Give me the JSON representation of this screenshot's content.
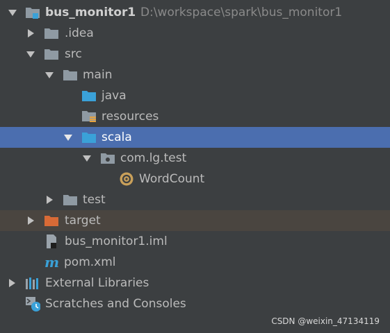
{
  "project": {
    "name": "bus_monitor1",
    "path": "D:\\workspace\\spark\\bus_monitor1"
  },
  "tree": {
    "idea": ".idea",
    "src": "src",
    "main": "main",
    "java": "java",
    "resources": "resources",
    "scala": "scala",
    "package": "com.lg.test",
    "wordcount": "WordCount",
    "test": "test",
    "target": "target",
    "iml": "bus_monitor1.iml",
    "pom": "pom.xml",
    "external_libraries": "External Libraries",
    "scratches": "Scratches and Consoles"
  },
  "watermark": "CSDN @weixin_47134119",
  "colors": {
    "selection": "#4b6eaf",
    "excluded_row": "#4a4540",
    "folder_gray": "#8f9aa3",
    "folder_blue": "#3aa1d8",
    "folder_orange": "#d86a36",
    "background": "#3c3f41"
  }
}
